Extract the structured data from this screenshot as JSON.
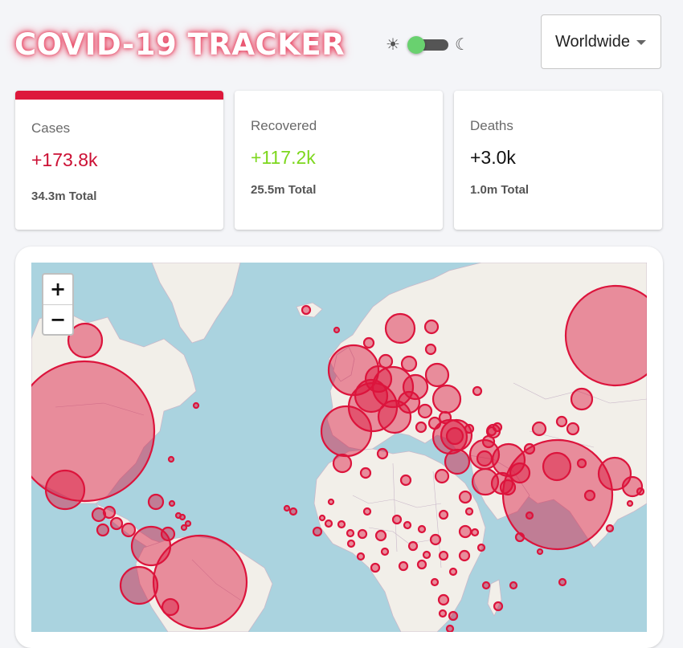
{
  "app": {
    "title": "COVID-19 TRACKER"
  },
  "theme_toggle": {
    "light_icon": "sun-icon",
    "dark_icon": "moon-icon",
    "light_glyph": "☀",
    "dark_glyph": "☾",
    "mode": "light"
  },
  "country_select": {
    "value": "Worldwide"
  },
  "cards": {
    "cases": {
      "label": "Cases",
      "delta": "+173.8k",
      "total": "34.3m Total",
      "active": true
    },
    "recovered": {
      "label": "Recovered",
      "delta": "+117.2k",
      "total": "25.5m Total"
    },
    "deaths": {
      "label": "Deaths",
      "delta": "+3.0k",
      "total": "1.0m Total"
    }
  },
  "map": {
    "zoom_in": "+",
    "zoom_out": "−"
  },
  "colors": {
    "accent": "#dd183b",
    "recovered": "#7dd71d",
    "ocean": "#aad3df",
    "land": "#f2efe9"
  }
}
